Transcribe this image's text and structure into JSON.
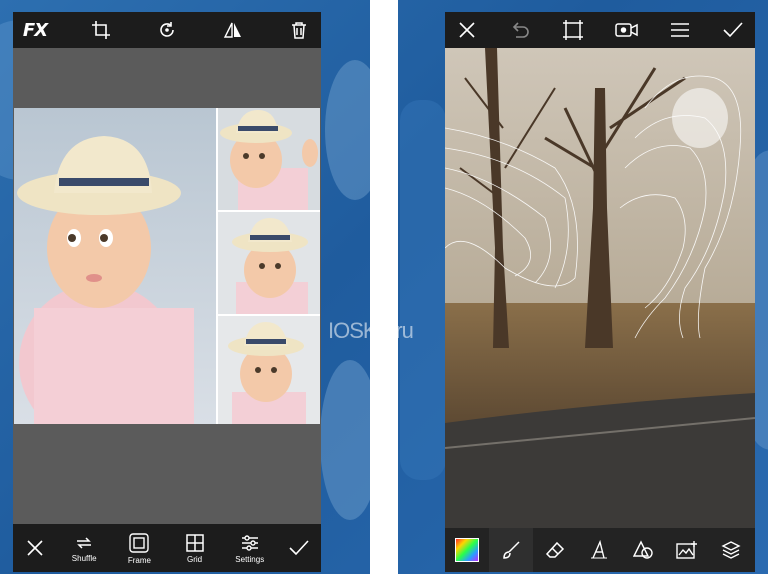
{
  "left_app": {
    "toolbar": {
      "fx_label": "FX",
      "icons": [
        "crop-icon",
        "rotate-icon",
        "flip-icon",
        "delete-icon"
      ]
    },
    "bottom": {
      "tools": [
        {
          "label": "Shuffle",
          "icon": "shuffle-icon"
        },
        {
          "label": "Frame",
          "icon": "frame-icon"
        },
        {
          "label": "Grid",
          "icon": "grid-icon"
        },
        {
          "label": "Settings",
          "icon": "settings-icon"
        }
      ]
    }
  },
  "right_app": {
    "toolbar": {
      "icons": [
        "close-icon",
        "undo-icon",
        "crop-icon",
        "video-icon",
        "menu-icon",
        "check-icon"
      ]
    },
    "bottom": {
      "tools": [
        "color-palette-icon",
        "brush-icon",
        "eraser-icon",
        "text-icon",
        "shape-icon",
        "image-add-icon",
        "layers-icon"
      ],
      "active_tool": "brush-icon"
    }
  },
  "watermark": "IOSKA.ru",
  "colors": {
    "toolbar_bg": "#1c1c1c",
    "background_blue": "#2d6fb0",
    "gray_band": "#5b5b5b"
  }
}
